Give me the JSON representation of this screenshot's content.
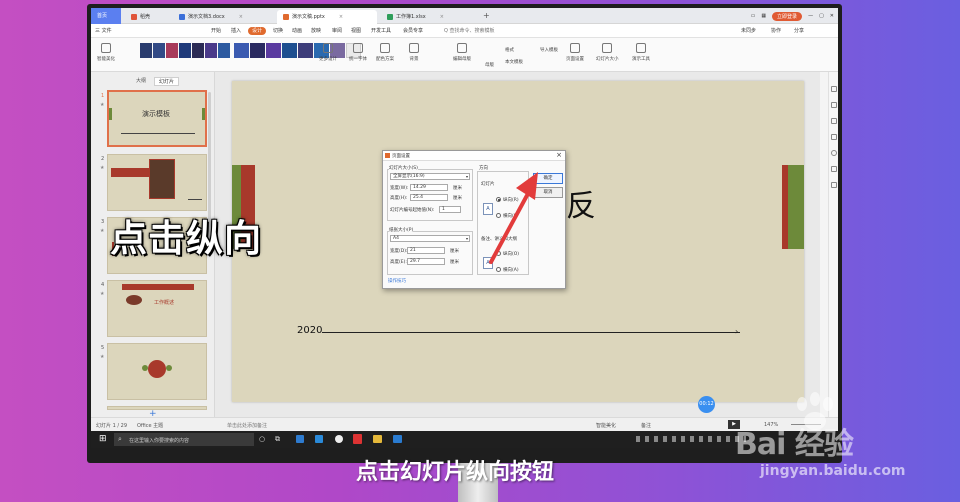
{
  "tabs": {
    "home": "首页",
    "items": [
      {
        "label": "稻壳",
        "color": "#e0553a"
      },
      {
        "label": "演示文档3.docx",
        "color": "#3b6fd9"
      },
      {
        "label": "演示文稿.pptx",
        "color": "#e06a2e"
      },
      {
        "label": "工作簿1.xlsx",
        "color": "#2e9d5a"
      }
    ],
    "add": "+",
    "login": "立即登录"
  },
  "menubar": {
    "file": "三 文件",
    "items": [
      "开始",
      "插入",
      "设计",
      "切换",
      "动画",
      "放映",
      "审阅",
      "视图",
      "开发工具",
      "会员专享"
    ],
    "active": "设计",
    "search": "Q 查找命令、搜索模板",
    "right": [
      "未同步",
      "协作",
      "分享"
    ]
  },
  "ribbon": {
    "smart": "智能美化",
    "more": "更多设计",
    "font": "统一字体",
    "palette": "配色方案",
    "background": "背景",
    "editmaster": "编辑母版",
    "format": "格式",
    "import": "导入模板",
    "master": "母版",
    "textbox": "本文模板",
    "pagesetup": "页面设置",
    "slidesize": "幻灯片大小",
    "tools": "演示工具"
  },
  "leftpanel": {
    "tab_outline": "大纲",
    "tab_slides": "幻灯片",
    "slides": [
      {
        "num": "1",
        "title": "演示模板"
      },
      {
        "num": "2",
        "title": ""
      },
      {
        "num": "3",
        "title": ""
      },
      {
        "num": "4",
        "title": "工作概述"
      },
      {
        "num": "5",
        "title": ""
      }
    ],
    "add": "+"
  },
  "slide": {
    "big_char": "反",
    "year": "2020"
  },
  "dialog": {
    "title": "页面设置",
    "size_label": "幻灯片大小(S)",
    "size_value": "全屏显示(16:9)",
    "width_label": "宽度(W):",
    "width_value": "14.29",
    "width_unit": "厘米",
    "height_label": "高度(H):",
    "height_value": "25.4",
    "height_unit": "厘米",
    "start_label": "幻灯片编号起始值(N):",
    "start_value": "1",
    "paper_label": "纸张大小(P)",
    "paper_value": "A4",
    "pw_label": "宽度(D):",
    "pw_value": "21",
    "pw_unit": "厘米",
    "ph_label": "高度(E):",
    "ph_value": "29.7",
    "ph_unit": "厘米",
    "tips": "操作技巧",
    "orient_label": "方向",
    "slide_orient": "幻灯片",
    "portrait": "纵向(R)",
    "landscape": "横向(L)",
    "notes_label": "备注、讲义和大纲",
    "notes_portrait": "纵向(O)",
    "notes_landscape": "横向(A)",
    "ok": "确定",
    "cancel": "取消"
  },
  "statusbar": {
    "slide_info": "幻灯片 1 / 29",
    "theme": "Office 主题",
    "notes": "单击此处添加备注",
    "smart": "智能美化",
    "remarks": "备注",
    "zoom": "147%"
  },
  "taskbar": {
    "search": "在这里输入你要搜索的内容"
  },
  "video": {
    "timer": "00:12"
  },
  "annotation": {
    "overlay": "点击纵向",
    "caption": "点击幻灯片纵向按钮"
  },
  "watermark": {
    "main": "Bai 经验",
    "sub": "jingyan.baidu.com"
  }
}
